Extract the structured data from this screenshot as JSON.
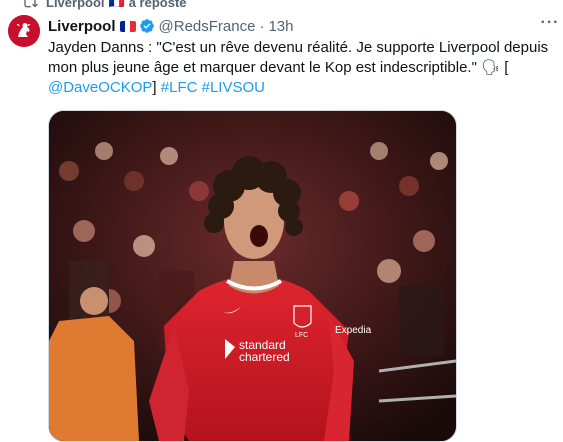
{
  "repost": {
    "account": "Liverpool",
    "flag": "🇫🇷",
    "action": "a reposté"
  },
  "tweet": {
    "author": "Liverpool",
    "handle": "@RedsFrance",
    "separator": "·",
    "time": "13h",
    "more_label": "···",
    "text_main": "Jayden Danns : \"C'est un rêve devenu réalité. Je supporte Liverpool depuis mon plus jeune âge et marquer devant le Kop est indescriptible.\" 🗣 [",
    "mention": "@DaveOCKOP",
    "text_bracket": "]",
    "hashtag_1": "#LFC",
    "hashtag_2": "#LIVSOU"
  },
  "media": {
    "shirt_text_1": "standard",
    "shirt_text_2": "chartered",
    "shirt_sleeve": "Expedia",
    "badge": "LFC"
  },
  "colors": {
    "accent": "#1d9bf0",
    "lfc_red": "#c8102e",
    "muted": "#536471"
  }
}
